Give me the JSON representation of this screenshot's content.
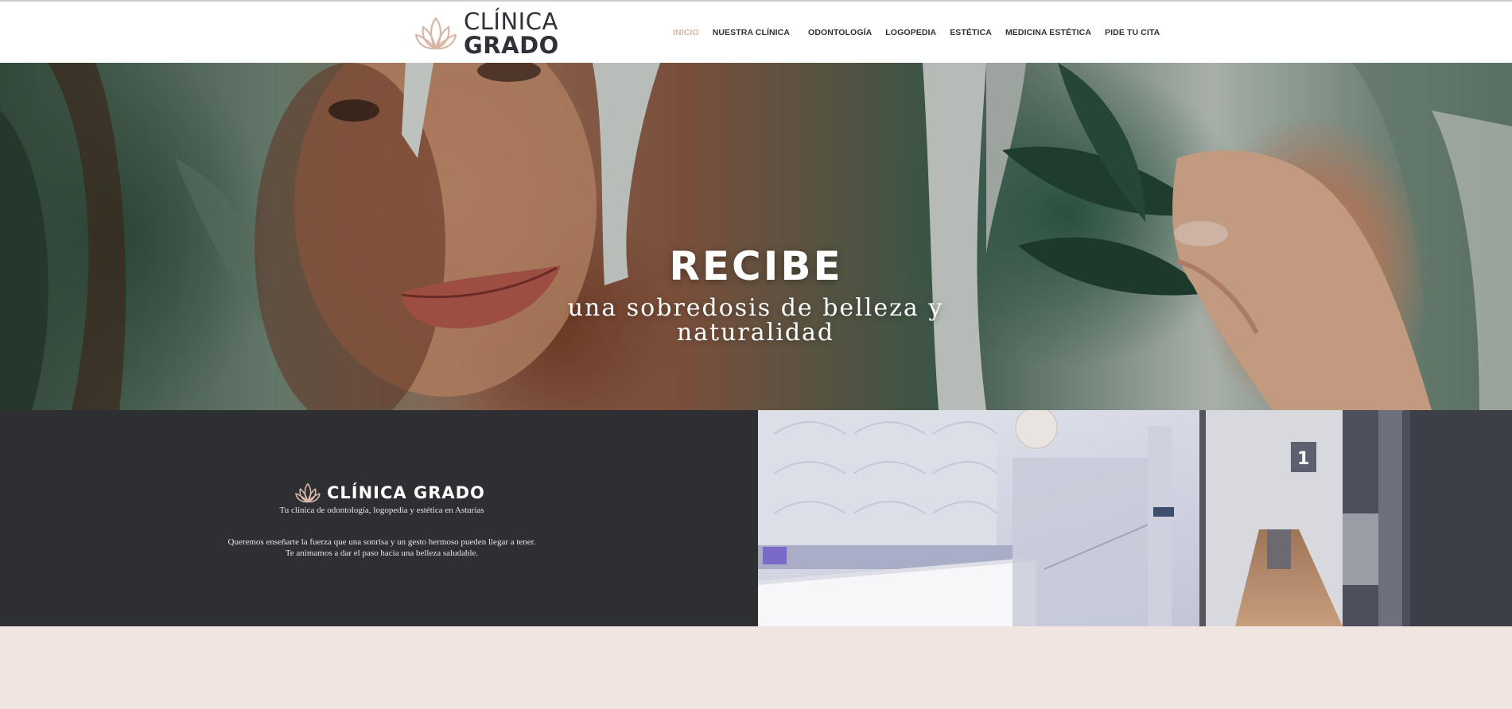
{
  "brand": {
    "line1": "CLÍNICA",
    "line2": "GRADO",
    "full_name": "CLÍNICA GRADO",
    "accent_color": "#d8b7a6",
    "dark_color": "#2e3138"
  },
  "nav": {
    "items": [
      {
        "label": "INICIO",
        "active": true
      },
      {
        "label": "NUESTRA CLÍNICA",
        "active": false
      },
      {
        "label": "ODONTOLOGÍA",
        "active": false
      },
      {
        "label": "LOGOPEDIA",
        "active": false
      },
      {
        "label": "ESTÉTICA",
        "active": false
      },
      {
        "label": "MEDICINA ESTÉTICA",
        "active": false
      },
      {
        "label": "PIDE TU CITA",
        "active": false
      }
    ]
  },
  "hero": {
    "title": "RECIBE",
    "subtitle": "una sobredosis de belleza y naturalidad"
  },
  "about": {
    "tagline": "Tu clínica de odontología, logopedia y estética en Asturias",
    "text_line1": "Queremos enseñarte la fuerza que una sonrisa y un gesto hermoso pueden llegar a tener.",
    "text_line2": "Te animamos a dar el paso hacia una belleza saludable.",
    "background": "#2e2f33"
  },
  "photo": {
    "door_number": "1"
  },
  "bottom": {
    "background": "#f0e5e1"
  }
}
